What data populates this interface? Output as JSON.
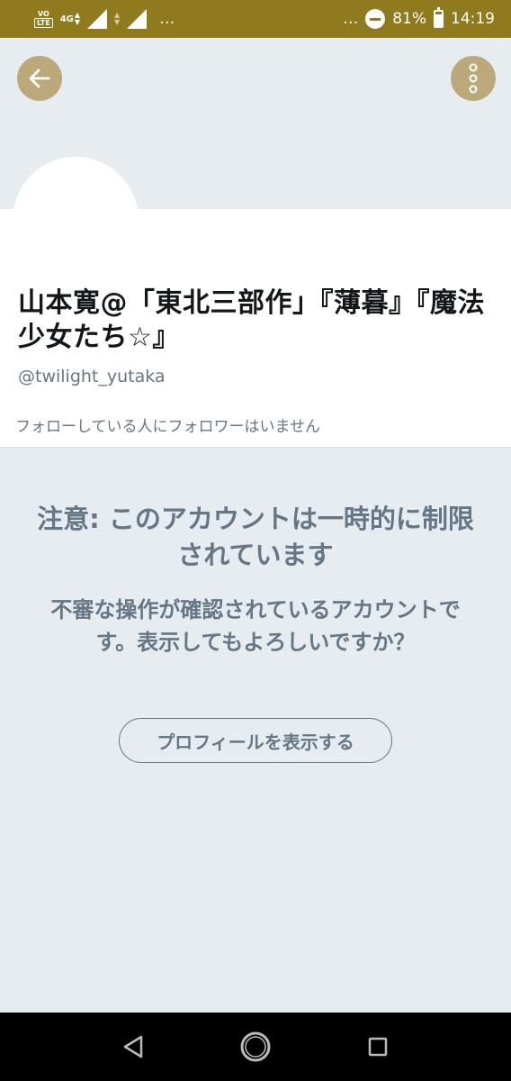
{
  "status_bar": {
    "volte_top": "VO",
    "volte_bottom": "LTE",
    "network": "4G",
    "overflow_left": "…",
    "overflow_right": "…",
    "battery_percent": "81%",
    "battery_level": 0.81,
    "time": "14:19"
  },
  "profile": {
    "display_name": "山本寛@「東北三部作」『薄暮』『魔法少女たち☆』",
    "handle": "@twilight_yutaka",
    "followers_note": "フォローしている人にフォロワーはいません"
  },
  "warning": {
    "title": "注意: このアカウントは一時的に制限されています",
    "body": "不審な操作が確認されているアカウントです。表示してもよろしいですか？",
    "button_label": "プロフィールを表示する"
  },
  "icons": {
    "back": "arrow-left-icon",
    "more": "more-vertical-icon",
    "nav_back": "triangle-back-icon",
    "nav_home": "circle-home-icon",
    "nav_recents": "square-recents-icon"
  },
  "colors": {
    "status_bar": "#8f7a1e",
    "header_button": "#bba97c",
    "secondary_text": "#657786"
  }
}
